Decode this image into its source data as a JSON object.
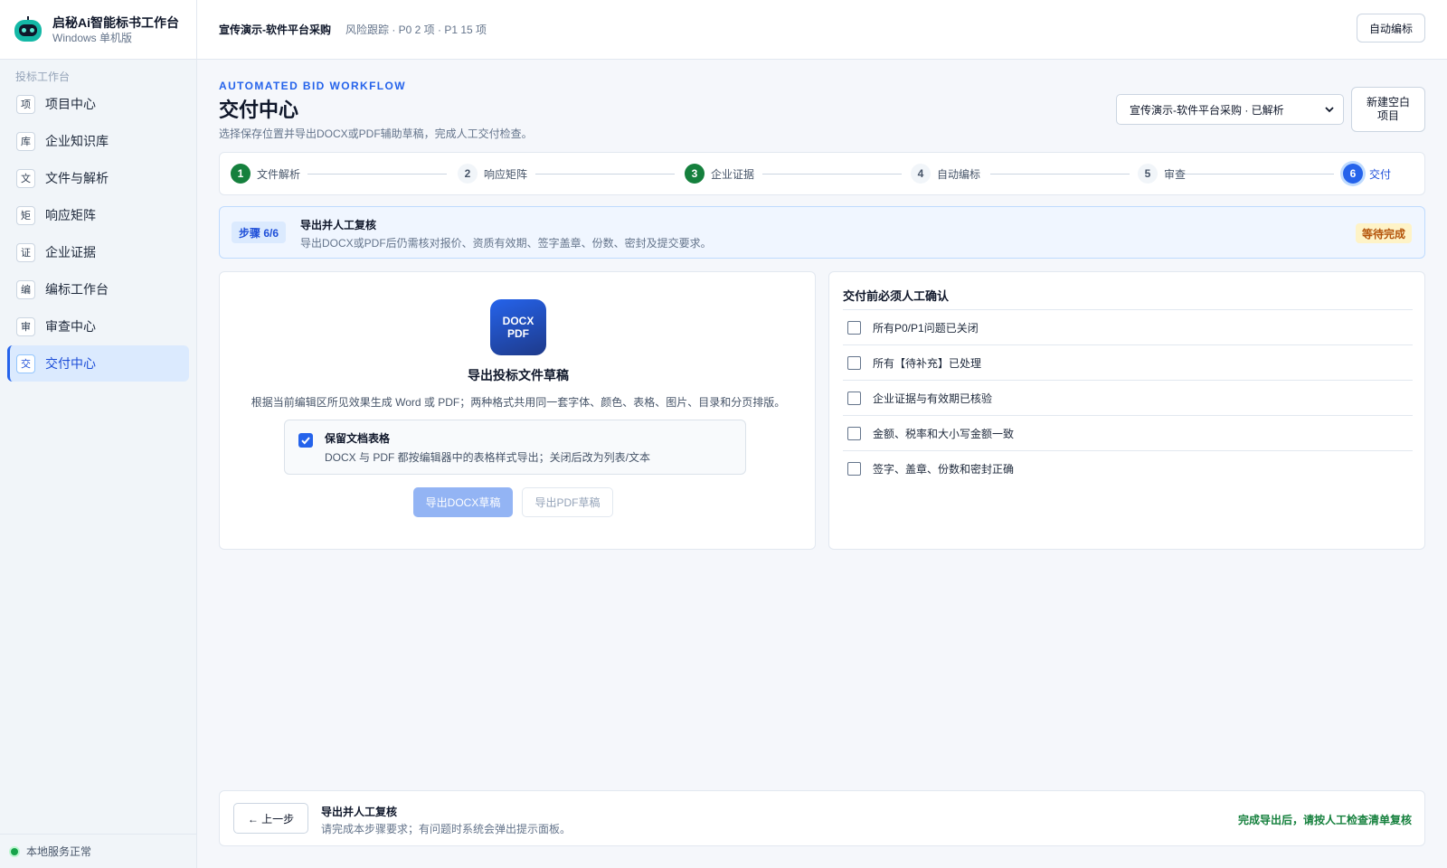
{
  "brand": {
    "title": "启秘Ai智能标书工作台",
    "subtitle": "Windows 单机版"
  },
  "sidebar": {
    "section": "投标工作台",
    "items": [
      {
        "badge": "项",
        "label": "项目中心"
      },
      {
        "badge": "库",
        "label": "企业知识库"
      },
      {
        "badge": "文",
        "label": "文件与解析"
      },
      {
        "badge": "矩",
        "label": "响应矩阵"
      },
      {
        "badge": "证",
        "label": "企业证据"
      },
      {
        "badge": "编",
        "label": "编标工作台"
      },
      {
        "badge": "审",
        "label": "审查中心"
      },
      {
        "badge": "交",
        "label": "交付中心"
      }
    ],
    "active_index": 7,
    "status": "本地服务正常",
    "status_color": "#16a34a"
  },
  "topbar": {
    "project": "宣传演示-软件平台采购",
    "risk": "风险跟踪 · P0 2 项 · P1 15 项",
    "auto_button": "自动编标"
  },
  "header": {
    "eyebrow": "AUTOMATED BID WORKFLOW",
    "title": "交付中心",
    "desc": "选择保存位置并导出DOCX或PDF辅助草稿，完成人工交付检查。",
    "project_select": "宣传演示-软件平台采购 · 已解析",
    "new_button": "新建空白项目"
  },
  "stepper": {
    "steps": [
      {
        "num": "1",
        "label": "文件解析",
        "state": "done"
      },
      {
        "num": "2",
        "label": "响应矩阵",
        "state": "pending"
      },
      {
        "num": "3",
        "label": "企业证据",
        "state": "done"
      },
      {
        "num": "4",
        "label": "自动编标",
        "state": "pending"
      },
      {
        "num": "5",
        "label": "审查",
        "state": "pending"
      },
      {
        "num": "6",
        "label": "交付",
        "state": "current"
      }
    ]
  },
  "banner": {
    "chip": "步骤 6/6",
    "title": "导出并人工复核",
    "desc": "导出DOCX或PDF后仍需核对报价、资质有效期、签字盖章、份数、密封及提交要求。",
    "status": "等待完成"
  },
  "export": {
    "icon_line1": "DOCX",
    "icon_line2": "PDF",
    "title": "导出投标文件草稿",
    "desc": "根据当前编辑区所见效果生成 Word 或 PDF；两种格式共用同一套字体、颜色、表格、图片、目录和分页排版。",
    "keep_title": "保留文档表格",
    "keep_desc": "DOCX 与 PDF 都按编辑器中的表格样式导出；关闭后改为列表/文本",
    "keep_checked": true,
    "docx_button": "导出DOCX草稿",
    "pdf_button": "导出PDF草稿"
  },
  "checklist": {
    "title": "交付前必须人工确认",
    "items": [
      "所有P0/P1问题已关闭",
      "所有【待补充】已处理",
      "企业证据与有效期已核验",
      "金额、税率和大小写金额一致",
      "签字、盖章、份数和密封正确"
    ]
  },
  "footer": {
    "back_button": "← 上一步",
    "title": "导出并人工复核",
    "desc": "请完成本步骤要求；有问题时系统会弹出提示面板。",
    "hint": "完成导出后，请按人工检查清单复核"
  },
  "colors": {
    "accent": "#2563eb",
    "done": "#15803d",
    "warning_text": "#b45309",
    "active_nav_bg": "#dbeafe"
  }
}
